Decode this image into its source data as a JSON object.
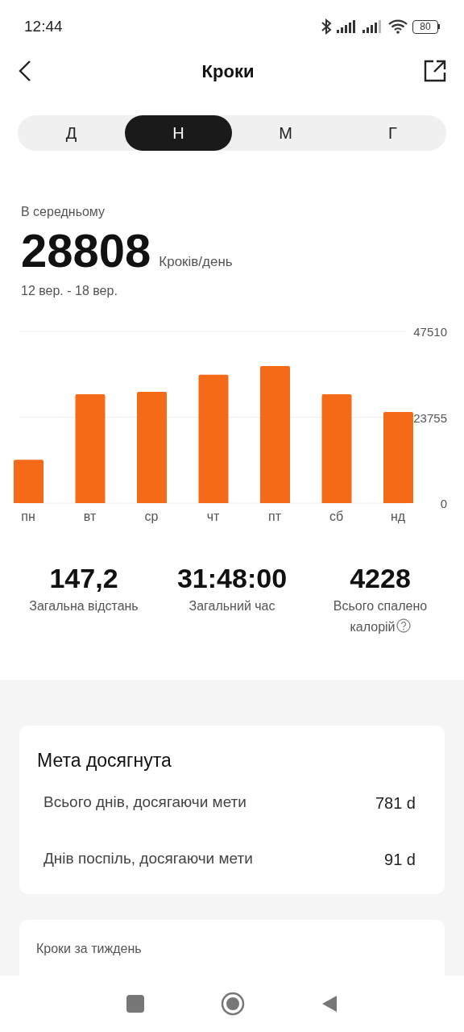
{
  "status_bar": {
    "time": "12:44",
    "battery": "80"
  },
  "header": {
    "title": "Кроки"
  },
  "tabs": [
    {
      "label": "Д",
      "selected": false
    },
    {
      "label": "Н",
      "selected": true
    },
    {
      "label": "М",
      "selected": false
    },
    {
      "label": "Г",
      "selected": false
    }
  ],
  "summary": {
    "label": "В середньому",
    "value": "28808",
    "unit": "Кроків/день",
    "range": "12 вер. - 18 вер."
  },
  "chart_data": {
    "type": "bar",
    "categories": [
      "пн",
      "вт",
      "ср",
      "чт",
      "пт",
      "сб",
      "нд"
    ],
    "series": [
      {
        "color": "#f56a18",
        "values": [
          12000,
          30100,
          30800,
          35500,
          37900,
          30100,
          25200
        ]
      }
    ],
    "ylim": [
      0,
      47510
    ],
    "yticks": [
      0,
      23755,
      47510
    ]
  },
  "stats": [
    {
      "value": "147,2",
      "label": "Загальна відстань",
      "help": false
    },
    {
      "value": "31:48:00",
      "label": "Загальний час",
      "help": false
    },
    {
      "value": "4228",
      "label": "Всього спалено калорій",
      "help": true
    }
  ],
  "goal_card": {
    "title": "Мета досягнута",
    "rows": [
      {
        "label": "Всього днів, досягаючи мети",
        "value": "781 d"
      },
      {
        "label": "Днів поспіль, досягаючи мети",
        "value": "91 d"
      }
    ]
  },
  "week_card": {
    "title": "Кроки за тиждень"
  }
}
